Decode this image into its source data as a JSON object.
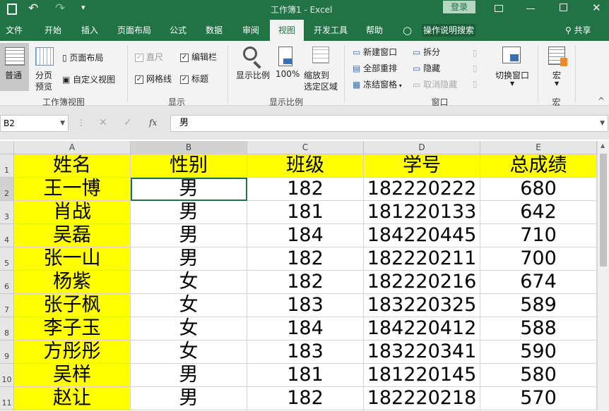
{
  "titlebar": {
    "title": "工作簿1  -  Excel",
    "login": "登录",
    "qat_more": "▾"
  },
  "tabs": [
    "文件",
    "开始",
    "插入",
    "页面布局",
    "公式",
    "数据",
    "审阅",
    "视图",
    "开发工具",
    "帮助"
  ],
  "tell_me": "操作说明搜索",
  "share": "共享",
  "ribbon": {
    "workbook_views": {
      "normal": "普通",
      "page_break_1": "分页",
      "page_break_2": "预览",
      "page_layout": "页面布局",
      "custom_views": "自定义视图",
      "group": "工作簿视图"
    },
    "show": {
      "ruler": "直尺",
      "formula_bar": "编辑栏",
      "gridlines": "网格线",
      "headings": "标题",
      "group": "显示"
    },
    "zoom": {
      "zoom": "显示比例",
      "hundred": "100%",
      "zoom_sel_1": "缩放到",
      "zoom_sel_2": "选定区域",
      "group": "显示比例"
    },
    "window": {
      "new_window": "新建窗口",
      "arrange_all": "全部重排",
      "freeze": "冻结窗格",
      "split": "拆分",
      "hide": "隐藏",
      "unhide": "取消隐藏",
      "switch": "切换窗口",
      "group": "窗口"
    },
    "macros": {
      "macros": "宏",
      "group": "宏"
    }
  },
  "formula_bar": {
    "name_box": "B2",
    "fx": "fx",
    "value": "男"
  },
  "columns": [
    "A",
    "B",
    "C",
    "D",
    "E"
  ],
  "rows": [
    [
      "姓名",
      "性别",
      "班级",
      "学号",
      "总成绩"
    ],
    [
      "王一博",
      "男",
      "182",
      "182220222",
      "680"
    ],
    [
      "肖战",
      "男",
      "181",
      "181220133",
      "642"
    ],
    [
      "吴磊",
      "男",
      "184",
      "184220445",
      "710"
    ],
    [
      "张一山",
      "男",
      "182",
      "182220211",
      "700"
    ],
    [
      "杨紫",
      "女",
      "182",
      "182220216",
      "674"
    ],
    [
      "张子枫",
      "女",
      "183",
      "183220325",
      "589"
    ],
    [
      "李子玉",
      "女",
      "184",
      "184220412",
      "588"
    ],
    [
      "方彤彤",
      "女",
      "183",
      "183220341",
      "590"
    ],
    [
      "吴样",
      "男",
      "181",
      "181220145",
      "580"
    ],
    [
      "赵让",
      "男",
      "182",
      "182220218",
      "570"
    ]
  ],
  "colors": {
    "green": "#217346",
    "highlight": "#ffff00"
  }
}
